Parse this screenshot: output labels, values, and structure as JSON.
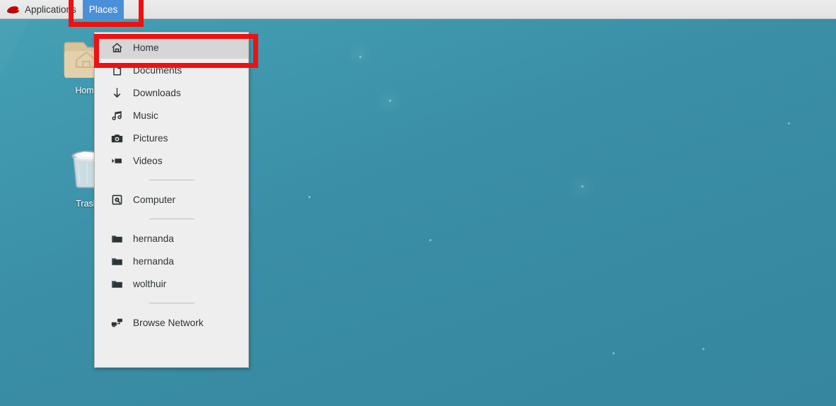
{
  "panel": {
    "applications_label": "Applications",
    "places_label": "Places",
    "logo_icon": "redhat-fedora-icon",
    "active_accent": "#4a90d9",
    "background": "#e9e9e9"
  },
  "desktop": {
    "background_color": "#3d94ab",
    "icons": [
      {
        "id": "home",
        "label": "Home",
        "icon": "home-folder-icon"
      },
      {
        "id": "trash",
        "label": "Trash",
        "icon": "trash-can-icon"
      }
    ]
  },
  "places_menu": {
    "items": [
      {
        "label": "Home",
        "icon": "home-icon",
        "selected": true,
        "type": "item"
      },
      {
        "label": "Documents",
        "icon": "document-icon",
        "selected": false,
        "type": "item"
      },
      {
        "label": "Downloads",
        "icon": "download-icon",
        "selected": false,
        "type": "item"
      },
      {
        "label": "Music",
        "icon": "music-note-icon",
        "selected": false,
        "type": "item"
      },
      {
        "label": "Pictures",
        "icon": "camera-icon",
        "selected": false,
        "type": "item"
      },
      {
        "label": "Videos",
        "icon": "video-icon",
        "selected": false,
        "type": "item"
      },
      {
        "type": "separator"
      },
      {
        "label": "Computer",
        "icon": "computer-icon",
        "selected": false,
        "type": "item"
      },
      {
        "type": "separator"
      },
      {
        "label": "hernanda",
        "icon": "folder-icon",
        "selected": false,
        "type": "item"
      },
      {
        "label": "hernanda",
        "icon": "folder-icon",
        "selected": false,
        "type": "item"
      },
      {
        "label": "wolthuir",
        "icon": "folder-icon",
        "selected": false,
        "type": "item"
      },
      {
        "type": "separator"
      },
      {
        "label": "Browse Network",
        "icon": "network-icon",
        "selected": false,
        "type": "item"
      }
    ],
    "highlight_color": "#d6d6d6",
    "background": "#eeeeee"
  },
  "annotations": {
    "color": "#ee1111",
    "boxes": [
      {
        "target": "places-menu-button"
      },
      {
        "target": "places-menu-home-item"
      }
    ]
  }
}
